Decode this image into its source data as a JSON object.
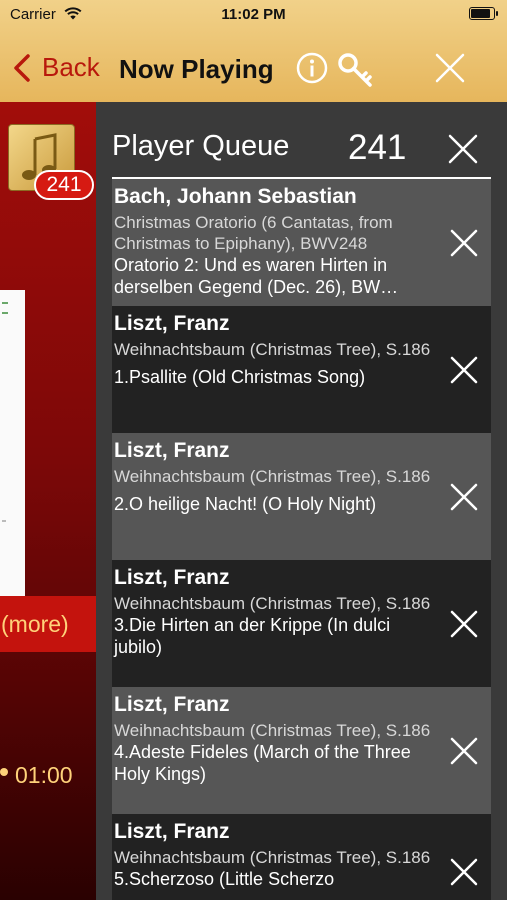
{
  "status_bar": {
    "carrier": "Carrier",
    "time": "11:02 PM"
  },
  "nav": {
    "back_label": "Back",
    "title": "Now Playing",
    "icons": [
      "chevron-left-icon",
      "info-icon",
      "key-icon",
      "close-icon"
    ],
    "accent_color": "#b8180c"
  },
  "background": {
    "badge_count": "241",
    "more_label": "(more)",
    "time_readout": "01:00"
  },
  "queue": {
    "title": "Player Queue",
    "count": "241",
    "items": [
      {
        "composer": "Bach, Johann Sebastian",
        "work": "Christmas Oratorio (6 Cantatas, from Christmas to Epiphany), BWV248",
        "movement": "Oratorio 2: Und es waren Hirten in derselben Gegend (Dec. 26), BW…"
      },
      {
        "composer": "Liszt, Franz",
        "work": "Weihnachtsbaum (Christmas Tree), S.186",
        "movement": "1.Psallite (Old Christmas Song)"
      },
      {
        "composer": "Liszt, Franz",
        "work": "Weihnachtsbaum (Christmas Tree), S.186",
        "movement": "2.O heilige Nacht! (O Holy Night)"
      },
      {
        "composer": "Liszt, Franz",
        "work": "Weihnachtsbaum (Christmas Tree), S.186",
        "movement": "3.Die Hirten an der Krippe (In dulci jubilo)"
      },
      {
        "composer": "Liszt, Franz",
        "work": "Weihnachtsbaum (Christmas Tree), S.186",
        "movement": "4.Adeste Fideles (March of the Three Holy Kings)"
      },
      {
        "composer": "Liszt, Franz",
        "work": "Weihnachtsbaum (Christmas Tree), S.186",
        "movement": "5.Scherzoso (Little Scherzo"
      }
    ]
  }
}
